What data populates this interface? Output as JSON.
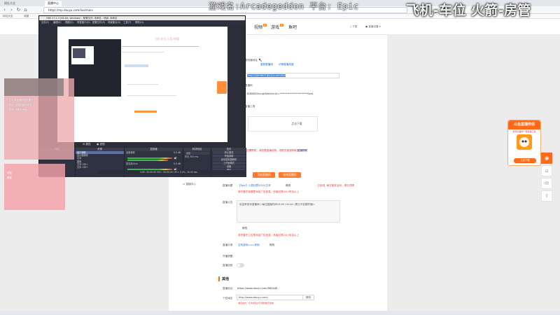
{
  "browser": {
    "tabs": [
      {
        "label": "网址大全"
      },
      {
        "label": "直播中心"
      }
    ],
    "url": "https://mp.douyu.com/live/main",
    "bookmarks": [
      "网址大全",
      "收藏",
      "应用",
      "斗鱼直播",
      "热门"
    ]
  },
  "overlay": {
    "game_line": "游戏名:Arcadegeddon 平台: Epic",
    "roles_line": "飞机-车位 火箭-房管",
    "small_top": "直播工具中心"
  },
  "site_nav": {
    "items": [
      {
        "label": "视频",
        "badge": "热"
      },
      {
        "label": "游戏",
        "badge": "热"
      },
      {
        "label": "鱼吧",
        "badge": ""
      }
    ],
    "right_text": "下载",
    "user_menu": "直播设置"
  },
  "stream_settings": {
    "server_label": "服务器地址",
    "server_value": "rtmp://sendtc3.douyu.com/live",
    "copy_server": "复制直播码",
    "switch_line": "切换直播线路",
    "code_label": "直播码",
    "code_value": "3860882hougtAfwSecret=**********************Sea1",
    "copy_code": "复制",
    "tool_label": "直播工具",
    "tool_download": "点击下载",
    "notice_red": "如需帮助，请查看直播说明，或联系客服获取更多帮助",
    "notice_link": "直播说明",
    "btn_start": "开启直播间",
    "btn_end": "结束直播间",
    "sidebar_item": "直播中心",
    "title_label": "直播标题",
    "title_value": "【Epic】人类社群2022(日本",
    "title_edit": "修改",
    "title_note_red": "【活动】每日抽奖活动，请见详情",
    "title_warn": "请不要在标题里添加广告信息，违者封禁24小时及以上",
    "announcement_label": "直播公告",
    "announcement_text": "欢迎来到本直播间～每日直播时间18:00-24:00～周日不定期开播～",
    "announcement_edit": "修改",
    "announcement_warn": "请不要在公告里添加广告信息，违者封禁24小时及以上",
    "category_label": "直播分类",
    "category_value": "主机游戏>>>其他",
    "category_edit": "修改",
    "remind_label": "开播提醒",
    "remind_toggle_label": "直播回放"
  },
  "other_section": {
    "title": "其他",
    "room_label": "直播地址",
    "room_value": "https://www.douyu.com/965448",
    "short_label": "个性域名",
    "short_value": "http://www.douyu.com/",
    "short_btn": "修改",
    "short_warn": "域名格式：仅支持英文字母和数字组成"
  },
  "obs": {
    "title": "OBS 27.1.3 (64-bit, windows) - 配置文件: 未命名 - 场景: 未命名",
    "menus": [
      "文件(F)",
      "编辑(E)",
      "视图(V)",
      "停靠窗口(D)",
      "配置文件(P)",
      "场景集合(S)",
      "工具(T)",
      "帮助(H)"
    ],
    "toolbar": [
      "属性",
      "滤镜"
    ],
    "docks": {
      "scenes_title": "场景",
      "sources_title": "来源",
      "sources": [
        "窗口捕获",
        "显示器捕获",
        "文本",
        "图像",
        "文本 GDI+",
        "文本 GDI+"
      ],
      "mixer_title": "混音器",
      "mixer_desktop": "桌面音频",
      "mixer_desktop_db": "0.0 dB",
      "mixer_mic": "麦克风/Aux",
      "mixer_mic_db": "0.0 dB",
      "transitions_title": "转场特效",
      "transition_value": "淡出",
      "duration_label": "时长",
      "duration_value": "300 ms",
      "controls_title": "控件",
      "controls": [
        "停止推流",
        "开始录制",
        "启动虚拟摄像机",
        "工作室模式",
        "设置",
        "退出"
      ]
    },
    "status": "LIVE: 00:00:00  REC: 00:00:00  CPU: 0.4%, 30.00 fps"
  },
  "overlay_panels": {
    "pink_lines": [
      "1)注1: 本直播间仅供娱乐",
      "1)提问: 出现房管请提问",
      "1)提问: 请联系房管"
    ],
    "pink_bottom_lines": [
      "房管",
      "房管"
    ]
  },
  "promo": {
    "title": "斗鱼直播伴侣",
    "subtitle": "新手必备的一键直播工具",
    "button": "立即下载"
  },
  "side_tools": [
    {
      "icon": "record-icon"
    },
    {
      "icon": "home-icon"
    },
    {
      "icon": "gift-icon"
    },
    {
      "icon": "upload-icon"
    }
  ]
}
